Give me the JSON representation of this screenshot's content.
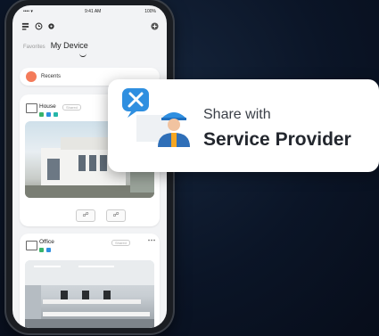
{
  "status_bar": {
    "time": "9:41 AM",
    "carrier": "•••• ▾",
    "battery": "100%"
  },
  "tabs": [
    {
      "label": "Favorites"
    },
    {
      "label": "My Device"
    }
  ],
  "recents": {
    "label": "Recents"
  },
  "devices": [
    {
      "name": "House",
      "share": "Shared"
    },
    {
      "name": "Office",
      "share": "Shared"
    }
  ],
  "popup": {
    "line1": "Share with",
    "line2": "Service Provider"
  },
  "colors": {
    "recents_dot": "#f47b5a",
    "badge_green": "#3ab36b",
    "badge_blue": "#2f8fe0",
    "badge_teal": "#25b6a8",
    "popup_icon_bg": "#2f8fe0"
  },
  "icons": [
    "scan-icon",
    "history-icon",
    "settings-icon",
    "add-icon",
    "house-icon",
    "office-icon",
    "lock-icon",
    "tools-icon",
    "technician-icon"
  ]
}
